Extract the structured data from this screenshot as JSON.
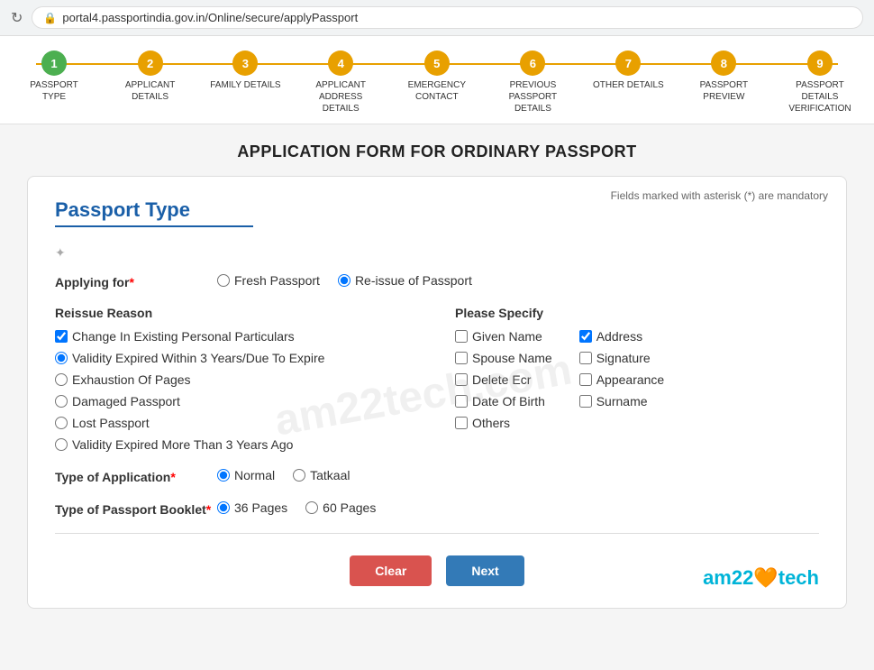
{
  "browser": {
    "url": "portal4.passportindia.gov.in/Online/secure/applyPassport",
    "reload_icon": "↻",
    "lock_icon": "🔒"
  },
  "steps": [
    {
      "number": "1",
      "label": "PASSPORT TYPE",
      "state": "active"
    },
    {
      "number": "2",
      "label": "APPLICANT DETAILS",
      "state": "pending"
    },
    {
      "number": "3",
      "label": "FAMILY DETAILS",
      "state": "pending"
    },
    {
      "number": "4",
      "label": "APPLICANT ADDRESS DETAILS",
      "state": "pending"
    },
    {
      "number": "5",
      "label": "EMERGENCY CONTACT",
      "state": "pending"
    },
    {
      "number": "6",
      "label": "PREVIOUS PASSPORT DETAILS",
      "state": "pending"
    },
    {
      "number": "7",
      "label": "OTHER DETAILS",
      "state": "pending"
    },
    {
      "number": "8",
      "label": "PASSPORT PREVIEW",
      "state": "pending"
    },
    {
      "number": "9",
      "label": "PASSPORT DETAILS VERIFICATION",
      "state": "pending"
    }
  ],
  "page_title": "APPLICATION FORM FOR ORDINARY PASSPORT",
  "mandatory_note": "Fields marked with asterisk (*) are mandatory",
  "section_title": "Passport Type",
  "applying_for": {
    "label": "Applying for",
    "required": true,
    "options": [
      {
        "value": "fresh",
        "label": "Fresh Passport",
        "checked": false
      },
      {
        "value": "reissue",
        "label": "Re-issue of Passport",
        "checked": true
      }
    ]
  },
  "reissue_reason": {
    "title": "Reissue Reason",
    "options": [
      {
        "value": "change_personal",
        "label": "Change In Existing Personal Particulars",
        "type": "checkbox",
        "checked": true
      },
      {
        "value": "validity_expired_3",
        "label": "Validity Expired Within 3 Years/Due To Expire",
        "type": "radio",
        "checked": true
      },
      {
        "value": "exhaustion",
        "label": "Exhaustion Of Pages",
        "type": "radio",
        "checked": false
      },
      {
        "value": "damaged",
        "label": "Damaged Passport",
        "type": "radio",
        "checked": false
      },
      {
        "value": "lost",
        "label": "Lost Passport",
        "type": "radio",
        "checked": false
      },
      {
        "value": "validity_expired_more",
        "label": "Validity Expired More Than 3 Years Ago",
        "type": "radio",
        "checked": false
      }
    ]
  },
  "please_specify": {
    "title": "Please Specify",
    "col1": [
      {
        "label": "Given Name",
        "checked": false
      },
      {
        "label": "Spouse Name",
        "checked": false
      },
      {
        "label": "Delete Ecr",
        "checked": false
      },
      {
        "label": "Date Of Birth",
        "checked": false
      },
      {
        "label": "Others",
        "checked": false
      }
    ],
    "col2": [
      {
        "label": "Address",
        "checked": true
      },
      {
        "label": "Signature",
        "checked": false
      },
      {
        "label": "Appearance",
        "checked": false
      },
      {
        "label": "Surname",
        "checked": false
      }
    ]
  },
  "type_of_application": {
    "label": "Type of Application",
    "required": true,
    "options": [
      {
        "value": "normal",
        "label": "Normal",
        "checked": true
      },
      {
        "value": "tatkaal",
        "label": "Tatkaal",
        "checked": false
      }
    ]
  },
  "type_of_passport_booklet": {
    "label": "Type of Passport Booklet",
    "required": true,
    "options": [
      {
        "value": "36",
        "label": "36 Pages",
        "checked": true
      },
      {
        "value": "60",
        "label": "60 Pages",
        "checked": false
      }
    ]
  },
  "buttons": {
    "clear": "Clear",
    "next": "Next"
  },
  "brand": {
    "text_start": "am22",
    "heart": "🧡",
    "text_end": "tech"
  },
  "watermark": "am22tech.com"
}
